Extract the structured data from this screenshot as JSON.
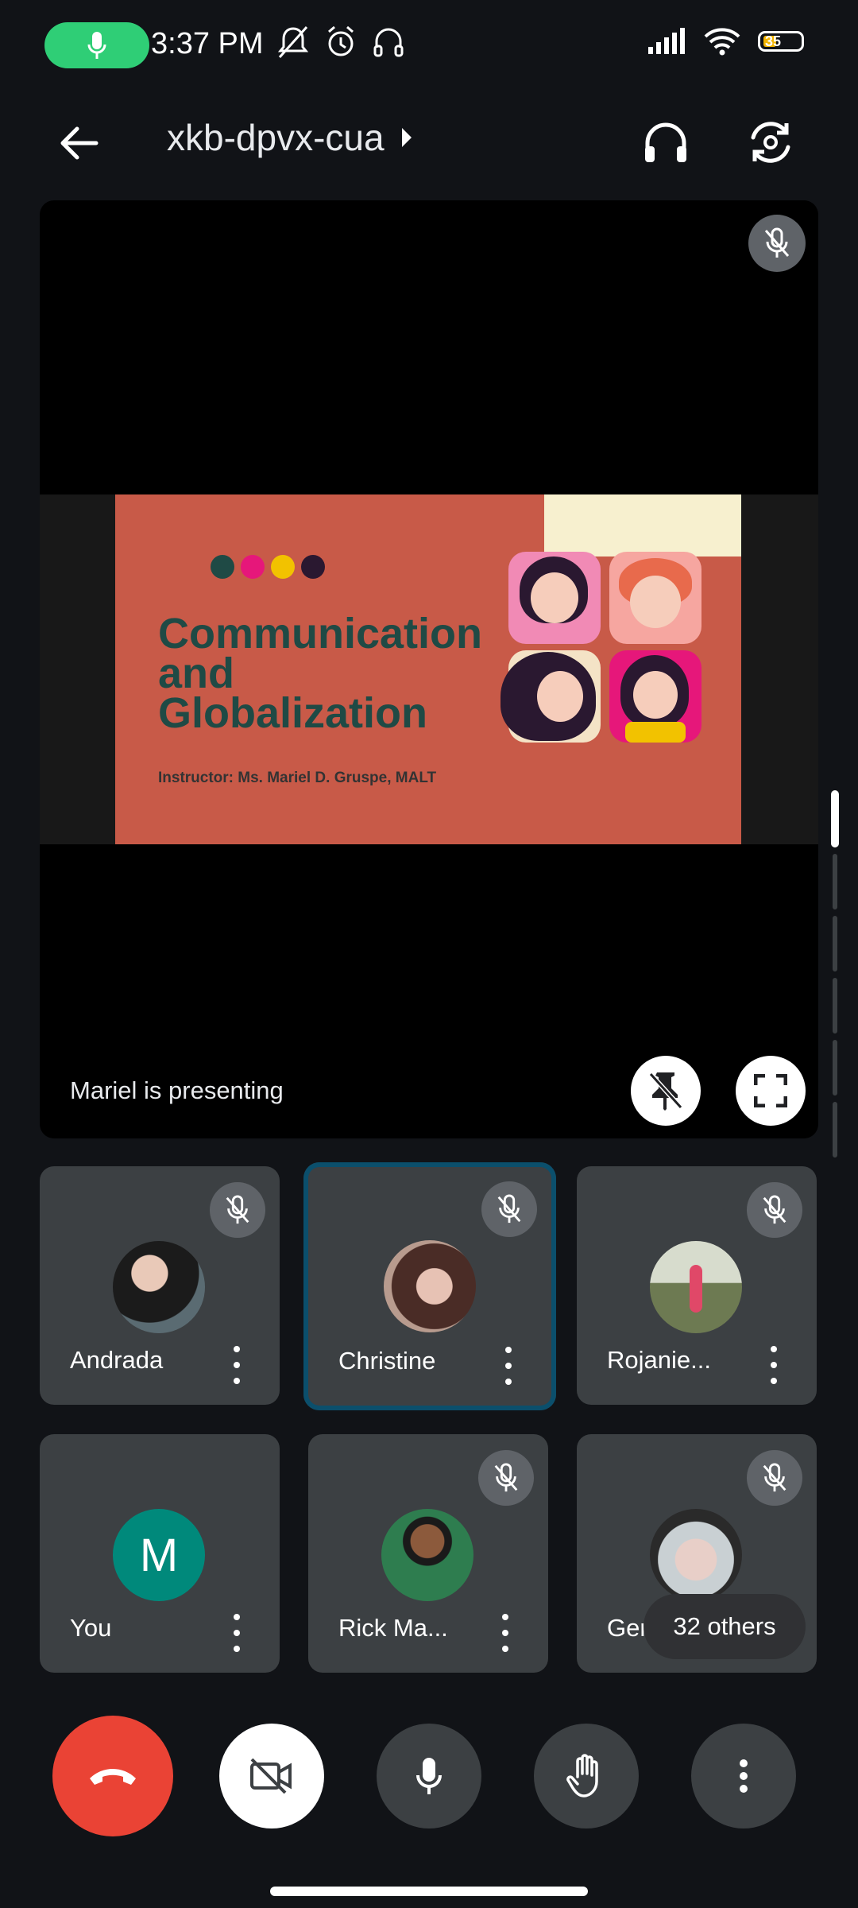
{
  "status_bar": {
    "time": "3:37 PM",
    "battery_level": "35",
    "colors": {
      "mic_pill": "#2fce76",
      "battery_fill": "#f2b400"
    }
  },
  "top_bar": {
    "meeting_code": "xkb-dpvx-cua",
    "icons": [
      "back-arrow-icon",
      "headphones-icon",
      "switch-camera-icon"
    ]
  },
  "presentation": {
    "slide_title_line1": "Communication",
    "slide_title_line2": "and",
    "slide_title_line3": "Globalization",
    "slide_instructor": "Instructor: Ms. Mariel D. Gruspe, MALT",
    "presenting_label": "Mariel is presenting",
    "slide_colors": {
      "background": "#c85a48",
      "title": "#1f4a45",
      "dots": [
        "#1f4a45",
        "#e6177a",
        "#f2c200",
        "#2a1830"
      ]
    }
  },
  "participants": [
    {
      "name": "Andrada",
      "muted": true,
      "active": false
    },
    {
      "name": "Christine",
      "muted": true,
      "active": true
    },
    {
      "name": "Rojanie...",
      "muted": true,
      "active": false
    },
    {
      "name": "You",
      "initial": "M",
      "muted": false,
      "active": false,
      "avatar_color": "#00897b"
    },
    {
      "name": "Rick Ma...",
      "muted": true,
      "active": false
    },
    {
      "name": "Geral",
      "muted": true,
      "active": false
    }
  ],
  "others_count_label": "32 others",
  "controls": {
    "icons": [
      "end-call-icon",
      "camera-off-icon",
      "microphone-icon",
      "raise-hand-icon",
      "more-options-icon"
    ],
    "end_call_color": "#ea4335"
  }
}
